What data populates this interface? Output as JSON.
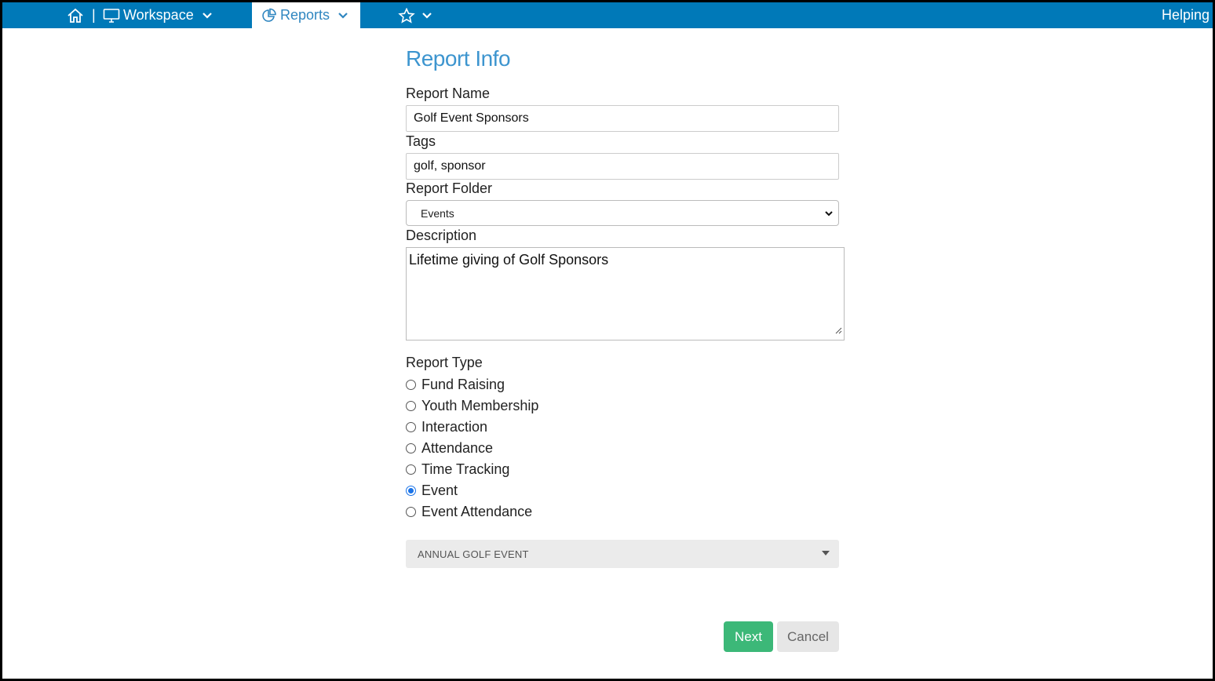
{
  "nav": {
    "workspace_label": "Workspace",
    "reports_label": "Reports",
    "helping_label": "Helping",
    "separator": "|",
    "colors": {
      "bar": "#0079b8",
      "active_text": "#2f86c0"
    }
  },
  "form": {
    "title": "Report Info",
    "report_name_label": "Report Name",
    "report_name_value": "Golf Event Sponsors",
    "tags_label": "Tags",
    "tags_value": "golf, sponsor",
    "folder_label": "Report Folder",
    "folder_value": "Events",
    "description_label": "Description",
    "description_value": "Lifetime giving of Golf Sponsors",
    "report_type_label": "Report Type",
    "report_types": [
      {
        "label": "Fund Raising",
        "checked": false
      },
      {
        "label": "Youth Membership",
        "checked": false
      },
      {
        "label": "Interaction",
        "checked": false
      },
      {
        "label": "Attendance",
        "checked": false
      },
      {
        "label": "Time Tracking",
        "checked": false
      },
      {
        "label": "Event",
        "checked": true
      },
      {
        "label": "Event Attendance",
        "checked": false
      }
    ],
    "event_select_value": "ANNUAL GOLF EVENT",
    "next_label": "Next",
    "cancel_label": "Cancel",
    "colors": {
      "title": "#3d95cf",
      "next_button": "#3cb878",
      "radio_checked": "#1a73e8"
    }
  }
}
